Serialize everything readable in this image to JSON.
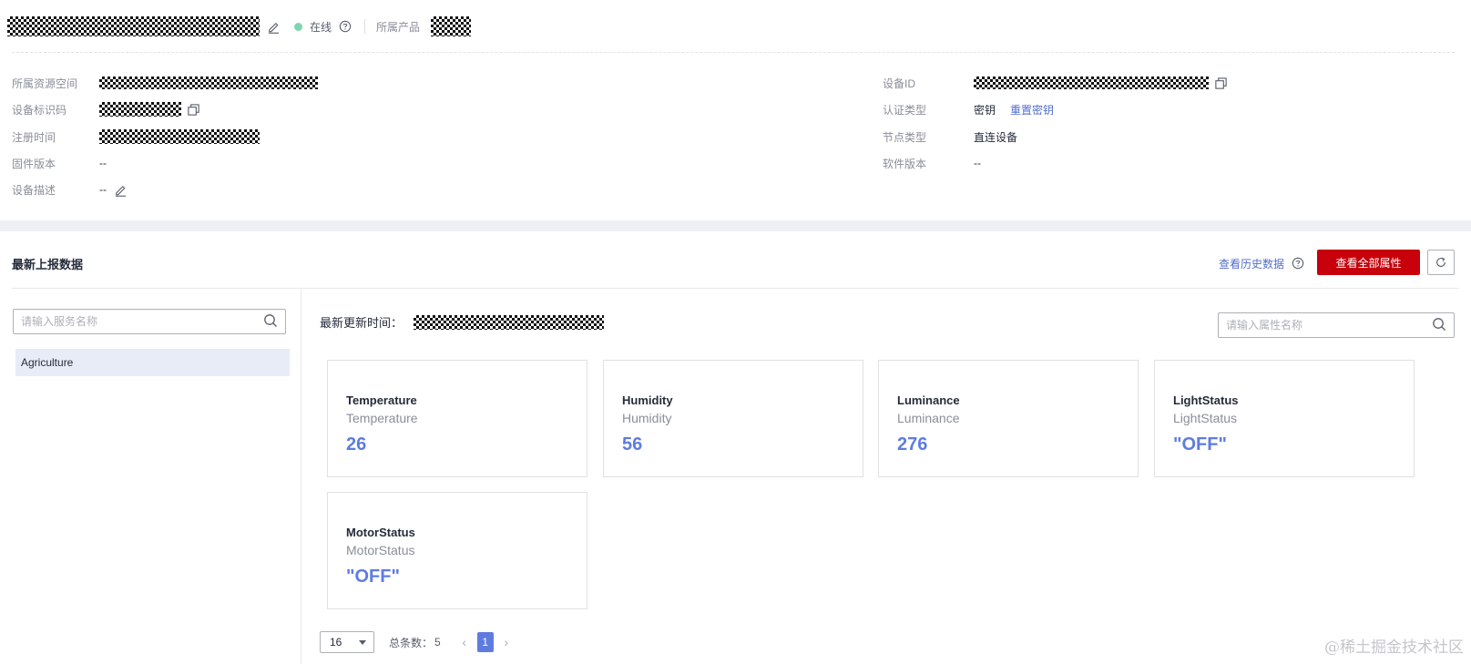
{
  "header": {
    "status": "在线",
    "product_label": "所属产品"
  },
  "info": {
    "left": [
      {
        "label": "所属资源空间",
        "value": ""
      },
      {
        "label": "设备标识码",
        "value": ""
      },
      {
        "label": "注册时间",
        "value": ""
      },
      {
        "label": "固件版本",
        "value": "--"
      },
      {
        "label": "设备描述",
        "value": "--"
      }
    ],
    "right": [
      {
        "label": "设备ID",
        "value": ""
      },
      {
        "label": "认证类型",
        "value": "密钥",
        "link": "重置密钥"
      },
      {
        "label": "节点类型",
        "value": "直连设备"
      },
      {
        "label": "软件版本",
        "value": "--"
      }
    ]
  },
  "latest": {
    "title": "最新上报数据",
    "history_link": "查看历史数据",
    "view_all_button": "查看全部属性",
    "service_search_placeholder": "请输入服务名称",
    "services": [
      "Agriculture"
    ],
    "update_time_label": "最新更新时间：",
    "property_search_placeholder": "请输入属性名称",
    "cards": [
      {
        "name": "Temperature",
        "sub": "Temperature",
        "value": "26"
      },
      {
        "name": "Humidity",
        "sub": "Humidity",
        "value": "56"
      },
      {
        "name": "Luminance",
        "sub": "Luminance",
        "value": "276"
      },
      {
        "name": "LightStatus",
        "sub": "LightStatus",
        "value": "\"OFF\""
      },
      {
        "name": "MotorStatus",
        "sub": "MotorStatus",
        "value": "\"OFF\""
      }
    ]
  },
  "pagination": {
    "page_size": "16",
    "total_label": "总条数：",
    "total": "5",
    "current_page": "1"
  },
  "watermark": "@稀土掘金技术社区",
  "colors": {
    "online": "#7bd7b1",
    "primary_button": "#c7000b",
    "link": "#526ecc",
    "value": "#5e7ce0",
    "selected_service": "#e8ecf7"
  }
}
